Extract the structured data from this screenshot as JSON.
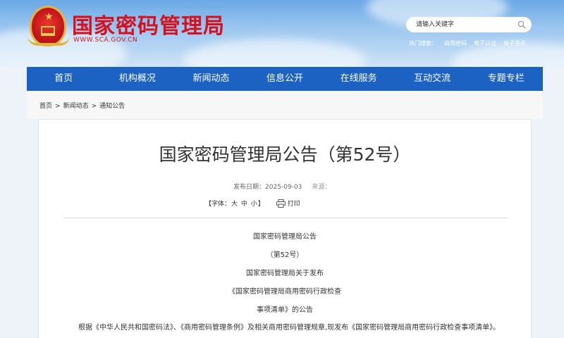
{
  "header": {
    "site_title": "国家密码管理局",
    "site_url": "WWW.SCA.GOV.CN",
    "search_placeholder": "请输入关键字",
    "hot_label": "热门搜索：",
    "hot_links": [
      "商用密码",
      "电子认证",
      "电子签名"
    ]
  },
  "nav": [
    "首页",
    "机构概况",
    "新闻动态",
    "信息公开",
    "在线服务",
    "互动交流",
    "专题专栏"
  ],
  "breadcrumb": [
    "首页",
    "新闻动态",
    "通知公告"
  ],
  "breadcrumb_sep": ">",
  "article": {
    "title": "国家密码管理局公告（第52号）",
    "date_label": "发布日期：2025-09-03",
    "source_label": "来源：",
    "font_size_label": "【字体：",
    "font_sizes": [
      "大",
      "中",
      "小"
    ],
    "font_size_close": "】",
    "print_label": "打印",
    "lines": [
      "国家密码管理局公告",
      "（第52号）",
      "国家密码管理局关于发布",
      "《国家密码管理局商用密码行政检查",
      "事项清单》的公告"
    ],
    "paragraph": "根据《中华人民共和国密码法》、《商用密码管理条例》及相关商用密码管理规章,现发布《国家密码管理局商用密码行政检查事项清单》。"
  },
  "colors": {
    "nav_bg": "#1c62c2",
    "title_red": "#d6111d"
  }
}
